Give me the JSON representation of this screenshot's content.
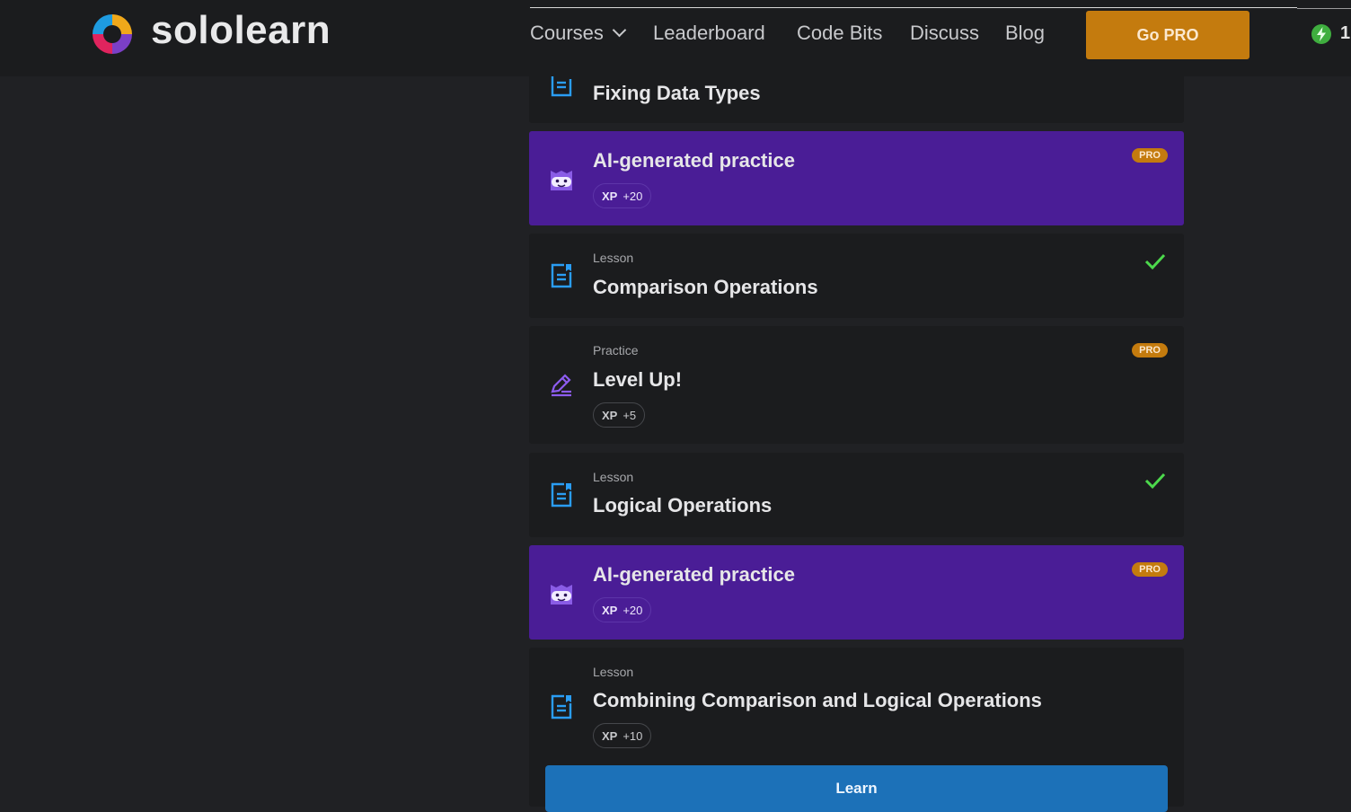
{
  "header": {
    "brand": "sololearn",
    "nav": {
      "courses": "Courses",
      "leaderboard": "Leaderboard",
      "code_bits": "Code Bits",
      "discuss": "Discuss",
      "blog": "Blog"
    },
    "go_pro": "Go PRO",
    "bolt_count": "1"
  },
  "items": [
    {
      "kind": "",
      "title": "Fixing Data Types",
      "icon": "lesson-icon"
    },
    {
      "kind": "",
      "title": "AI-generated practice",
      "xp_label": "XP",
      "xp_value": "+20",
      "badge": "PRO",
      "icon": "ai-bot-icon"
    },
    {
      "kind": "Lesson",
      "title": "Comparison Operations",
      "completed": true,
      "icon": "lesson-icon"
    },
    {
      "kind": "Practice",
      "title": "Level Up!",
      "xp_label": "XP",
      "xp_value": "+5",
      "badge": "PRO",
      "icon": "pencil-icon"
    },
    {
      "kind": "Lesson",
      "title": "Logical Operations",
      "completed": true,
      "icon": "lesson-icon"
    },
    {
      "kind": "",
      "title": "AI-generated practice",
      "xp_label": "XP",
      "xp_value": "+20",
      "badge": "PRO",
      "icon": "ai-bot-icon"
    },
    {
      "kind": "Lesson",
      "title": "Combining Comparison and Logical Operations",
      "xp_label": "XP",
      "xp_value": "+10",
      "icon": "lesson-icon"
    }
  ],
  "learn_button": "Learn",
  "colors": {
    "background": "#202124",
    "card": "#1b1c1e",
    "ai_card": "#4a1d96",
    "pro": "#c47b0e",
    "check": "#4cd94c",
    "learn": "#1c71b8"
  }
}
